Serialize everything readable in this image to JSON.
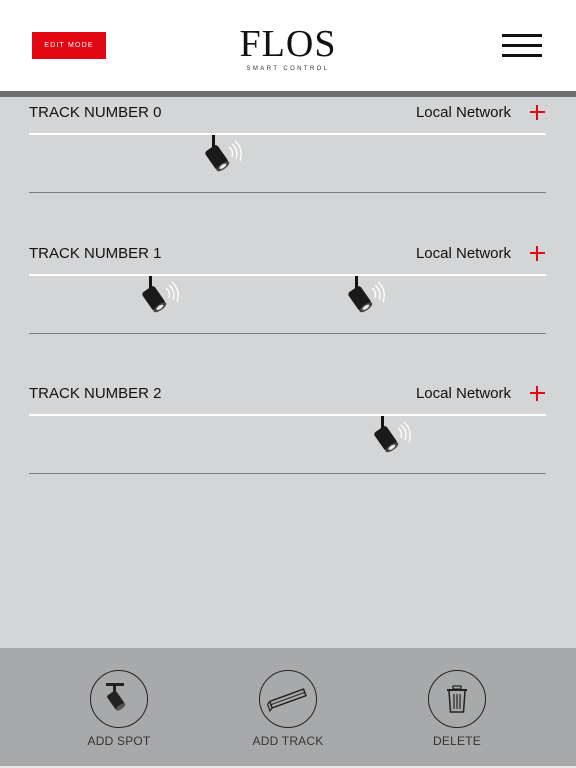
{
  "header": {
    "edit_mode_label": "EDIT MODE",
    "logo_text": "FLOS",
    "logo_subtitle": "SMART CONTROL"
  },
  "colors": {
    "accent": "#e30613",
    "background": "#d4d5d7",
    "header": "#ffffff",
    "toolbar": "#a8a9ab"
  },
  "tracks": [
    {
      "title": "TRACK NUMBER 0",
      "network": "Local Network"
    },
    {
      "title": "TRACK NUMBER 1",
      "network": "Local Network"
    },
    {
      "title": "TRACK NUMBER 2",
      "network": "Local Network"
    }
  ],
  "toolbar": {
    "add_spot_label": "ADD SPOT",
    "add_track_label": "ADD TRACK",
    "delete_label": "DELETE"
  },
  "icons": {
    "menu": "hamburger-menu-icon",
    "add": "plus-icon",
    "spot": "spotlight-icon",
    "track": "track-rail-icon",
    "delete": "trash-icon"
  }
}
